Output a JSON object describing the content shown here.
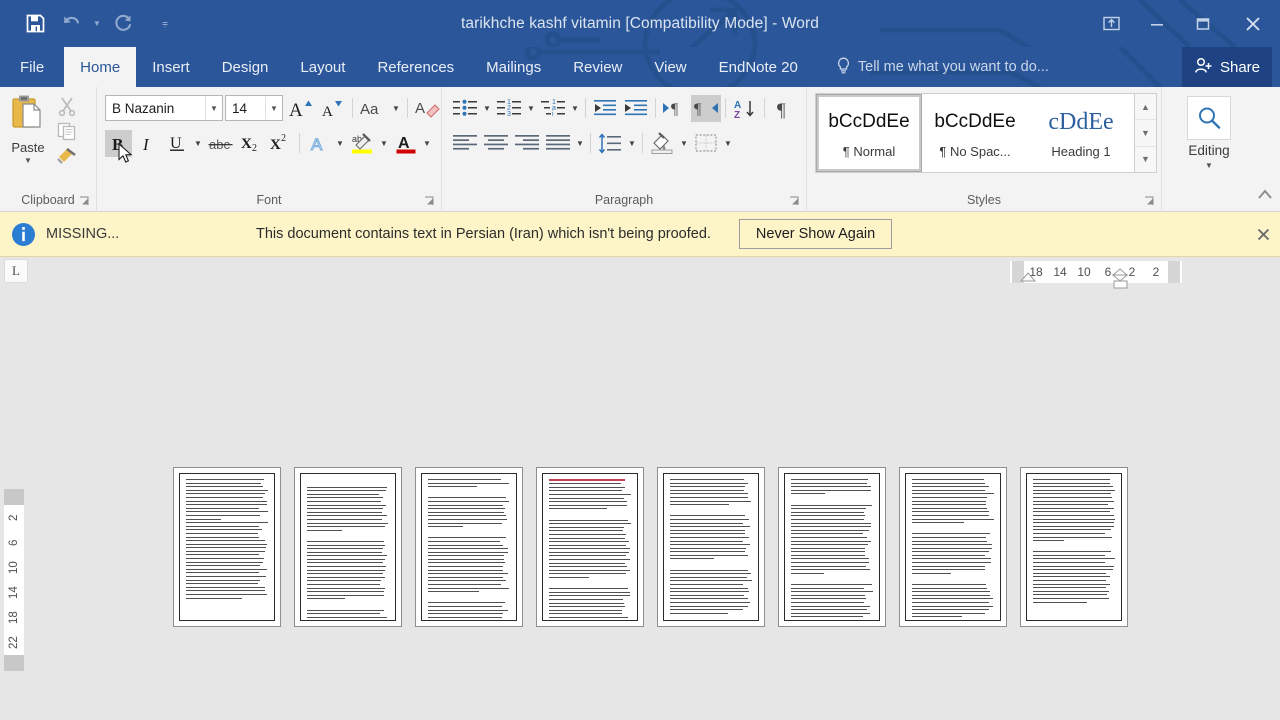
{
  "window": {
    "title": "tarikhche kashf vitamin [Compatibility Mode] - Word",
    "accent_color": "#2b579a",
    "quick_access": [
      {
        "label": "Save",
        "icon": "save-icon"
      },
      {
        "label": "Undo",
        "icon": "undo-icon"
      },
      {
        "label": "Redo",
        "icon": "redo-icon"
      },
      {
        "label": "Customize Quick Access Toolbar",
        "icon": "chevron-down-icon"
      }
    ],
    "controls": [
      {
        "label": "Ribbon Display Options",
        "icon": "ribbon-display-icon"
      },
      {
        "label": "Minimize",
        "icon": "minimize-icon"
      },
      {
        "label": "Restore Down",
        "icon": "restore-icon"
      },
      {
        "label": "Close",
        "icon": "close-icon"
      }
    ]
  },
  "tabs": [
    {
      "label": "File",
      "active": false
    },
    {
      "label": "Home",
      "active": true
    },
    {
      "label": "Insert",
      "active": false
    },
    {
      "label": "Design",
      "active": false
    },
    {
      "label": "Layout",
      "active": false
    },
    {
      "label": "References",
      "active": false
    },
    {
      "label": "Mailings",
      "active": false
    },
    {
      "label": "Review",
      "active": false
    },
    {
      "label": "View",
      "active": false
    },
    {
      "label": "EndNote 20",
      "active": false
    }
  ],
  "tell_me": {
    "placeholder": "Tell me what you want to do...",
    "icon": "lightbulb-icon"
  },
  "share": {
    "label": "Share",
    "icon": "share-person-icon"
  },
  "ribbon": {
    "groups": [
      {
        "label": "Clipboard"
      },
      {
        "label": "Font"
      },
      {
        "label": "Paragraph"
      },
      {
        "label": "Styles"
      }
    ],
    "clipboard": {
      "paste_label": "Paste",
      "buttons": [
        "Cut",
        "Copy",
        "Format Painter"
      ]
    },
    "font": {
      "font_name": "B Nazanin",
      "font_size": "14",
      "grow_font": "Increase Font Size",
      "shrink_font": "Decrease Font Size",
      "change_case": "Aa",
      "clear_formatting": "Clear All Formatting",
      "bold": "B",
      "bold_active": true,
      "italic": "I",
      "underline": "U",
      "strikethrough": "abc",
      "subscript": "X2",
      "superscript": "X2",
      "text_effects": "A",
      "highlight": "Text Highlight Color",
      "font_color": "Font Color",
      "highlight_color": "#ffff00",
      "font_color_swatch": "#d00000"
    },
    "paragraph": {
      "bullets": "Bullets",
      "numbering": "Numbering",
      "multilevel": "Multilevel List",
      "decrease_indent": "Decrease Indent",
      "increase_indent": "Increase Indent",
      "ltr": "Left-to-Right Text Direction",
      "rtl": "Right-to-Left Text Direction",
      "rtl_active": true,
      "sort": "Sort",
      "show_marks": "Show/Hide Paragraph Marks",
      "align_left": "Align Left",
      "align_center": "Center",
      "align_right": "Align Right",
      "justify": "Justify",
      "line_spacing": "Line and Paragraph Spacing",
      "shading": "Shading",
      "borders": "Borders"
    },
    "styles": {
      "items": [
        {
          "preview": "bCcDdEe",
          "name": "¶ Normal",
          "selected": true
        },
        {
          "preview": "bCcDdEe",
          "name": "¶ No Spac...",
          "selected": false
        },
        {
          "preview": "cDdEe",
          "name": "Heading 1",
          "selected": false
        }
      ]
    },
    "editing": {
      "label": "Editing",
      "icon": "search-icon"
    }
  },
  "message_bar": {
    "icon": "info-icon",
    "short_label": "MISSING...",
    "text": "This document contains text in Persian (Iran) which isn't being proofed.",
    "button": "Never Show Again",
    "close": "×",
    "background": "#fdf5c8"
  },
  "rulers": {
    "tab_selector": "L",
    "horizontal_marks": [
      "18",
      "14",
      "10",
      "6",
      "2",
      "2"
    ],
    "vertical_marks": [
      "2",
      "2",
      "6",
      "10",
      "14",
      "18",
      "22"
    ]
  },
  "document": {
    "view": "multiple-pages",
    "page_count": 8,
    "pages": [
      {
        "number": 1,
        "blocks": [
          12,
          22
        ]
      },
      {
        "number": 2,
        "blocks": [
          1,
          13,
          1,
          17,
          1,
          4
        ]
      },
      {
        "number": 3,
        "blocks": [
          3,
          1,
          9,
          1,
          16,
          1,
          7
        ]
      },
      {
        "number": 4,
        "blocks": [
          9,
          1,
          17,
          1,
          10
        ],
        "has_red_text": true
      },
      {
        "number": 5,
        "blocks": [
          8,
          1,
          13,
          1,
          13
        ]
      },
      {
        "number": 6,
        "blocks": [
          5,
          1,
          20,
          1,
          11
        ]
      },
      {
        "number": 7,
        "blocks": [
          13,
          1,
          12,
          1,
          10
        ]
      },
      {
        "number": 8,
        "blocks": [
          18,
          1,
          15
        ]
      }
    ]
  }
}
